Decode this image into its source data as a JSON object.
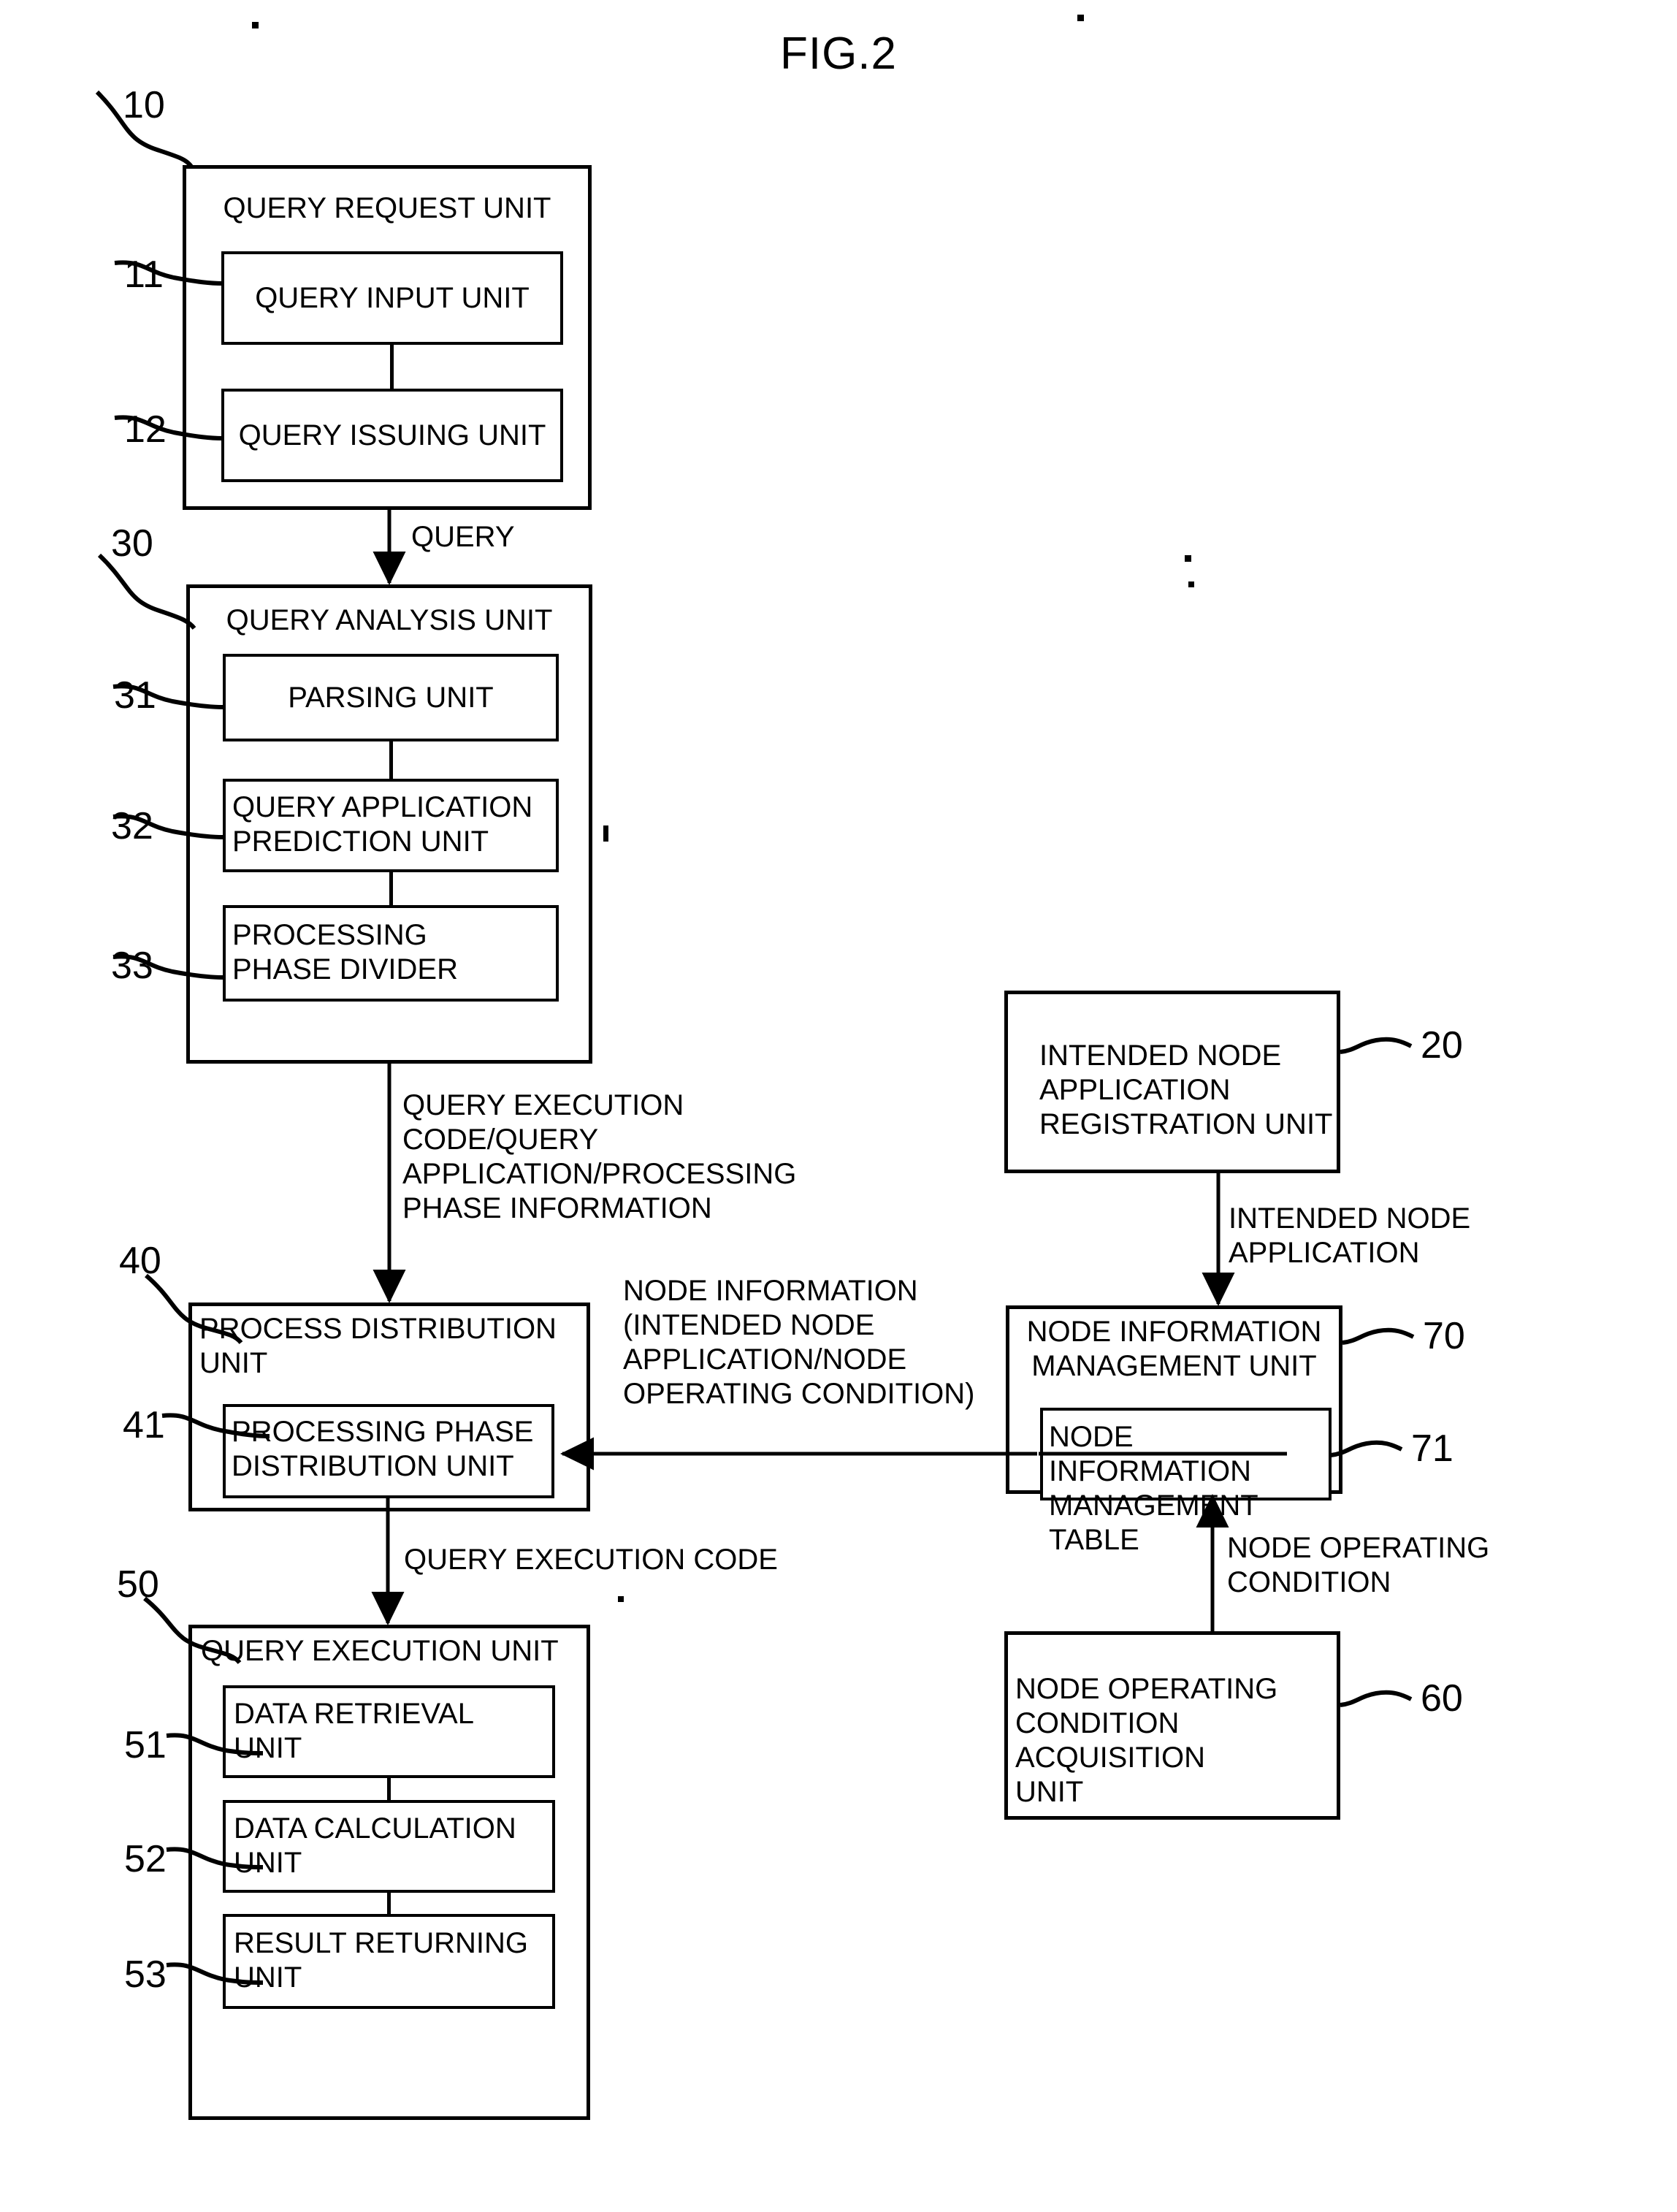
{
  "figure": {
    "title": "FIG.2"
  },
  "blocks": {
    "query_request_unit": {
      "ref": "10",
      "title": "QUERY REQUEST UNIT",
      "children": [
        {
          "ref": "11",
          "label": "QUERY INPUT UNIT"
        },
        {
          "ref": "12",
          "label": "QUERY ISSUING UNIT"
        }
      ]
    },
    "query_analysis_unit": {
      "ref": "30",
      "title": "QUERY ANALYSIS UNIT",
      "children": [
        {
          "ref": "31",
          "label": "PARSING UNIT"
        },
        {
          "ref": "32",
          "label": "QUERY APPLICATION\nPREDICTION UNIT"
        },
        {
          "ref": "33",
          "label": "PROCESSING\nPHASE DIVIDER"
        }
      ]
    },
    "process_distribution_unit": {
      "ref": "40",
      "title": "PROCESS DISTRIBUTION\nUNIT",
      "children": [
        {
          "ref": "41",
          "label": "PROCESSING PHASE\nDISTRIBUTION UNIT"
        }
      ]
    },
    "query_execution_unit": {
      "ref": "50",
      "title": "QUERY EXECUTION UNIT",
      "children": [
        {
          "ref": "51",
          "label": "DATA RETRIEVAL\nUNIT"
        },
        {
          "ref": "52",
          "label": "DATA CALCULATION\nUNIT"
        },
        {
          "ref": "53",
          "label": "RESULT RETURNING\nUNIT"
        }
      ]
    },
    "intended_node_application_registration_unit": {
      "ref": "20",
      "title": "INTENDED NODE\nAPPLICATION\nREGISTRATION UNIT"
    },
    "node_information_management_unit": {
      "ref": "70",
      "title": "NODE INFORMATION\nMANAGEMENT UNIT",
      "children": [
        {
          "ref": "71",
          "label": "NODE INFORMATION\nMANAGEMENT TABLE"
        }
      ]
    },
    "node_operating_condition_acquisition_unit": {
      "ref": "60",
      "title": "NODE OPERATING\nCONDITION ACQUISITION\nUNIT"
    }
  },
  "flow_labels": {
    "query": "QUERY",
    "query_execution_code_info": "QUERY EXECUTION\nCODE/QUERY\nAPPLICATION/PROCESSING\nPHASE INFORMATION",
    "query_execution_code": "QUERY EXECUTION CODE",
    "node_information": "NODE INFORMATION\n(INTENDED NODE\nAPPLICATION/NODE\nOPERATING CONDITION)",
    "intended_node_application": "INTENDED NODE\nAPPLICATION",
    "node_operating_condition": "NODE OPERATING\nCONDITION"
  },
  "colors": {
    "ink": "#000000",
    "paper": "#ffffff"
  }
}
